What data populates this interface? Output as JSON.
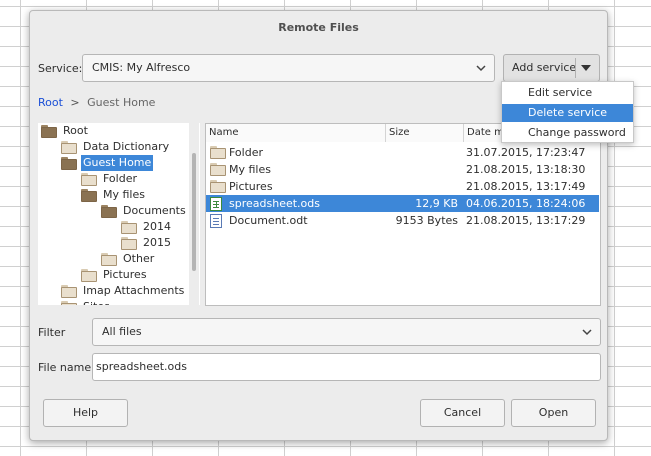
{
  "dialog": {
    "title": "Remote Files"
  },
  "service": {
    "label": "Service:",
    "value": "CMIS: My Alfresco",
    "add_button": "Add service"
  },
  "service_menu": {
    "items": [
      {
        "label": "Edit service",
        "highlighted": false
      },
      {
        "label": "Delete service",
        "highlighted": true
      },
      {
        "label": "Change password",
        "highlighted": false
      }
    ]
  },
  "breadcrumb": {
    "root": "Root",
    "separator": ">",
    "current": "Guest Home"
  },
  "tree": {
    "items": [
      {
        "label": "Root",
        "depth": 0,
        "open": true,
        "selected": false
      },
      {
        "label": "Data Dictionary",
        "depth": 1,
        "open": false,
        "selected": false
      },
      {
        "label": "Guest Home",
        "depth": 1,
        "open": true,
        "selected": true
      },
      {
        "label": "Folder",
        "depth": 2,
        "open": false,
        "selected": false
      },
      {
        "label": "My files",
        "depth": 2,
        "open": true,
        "selected": false
      },
      {
        "label": "Documents",
        "depth": 3,
        "open": true,
        "selected": false
      },
      {
        "label": "2014",
        "depth": 4,
        "open": false,
        "selected": false
      },
      {
        "label": "2015",
        "depth": 4,
        "open": false,
        "selected": false
      },
      {
        "label": "Other",
        "depth": 3,
        "open": false,
        "selected": false
      },
      {
        "label": "Pictures",
        "depth": 2,
        "open": false,
        "selected": false
      },
      {
        "label": "Imap Attachments",
        "depth": 1,
        "open": false,
        "selected": false
      },
      {
        "label": "Sites",
        "depth": 1,
        "open": false,
        "selected": false
      }
    ]
  },
  "files": {
    "columns": {
      "name": "Name",
      "size": "Size",
      "date": "Date mo"
    },
    "rows": [
      {
        "name": "Folder",
        "size": "",
        "date": "31.07.2015, 17:23:47",
        "icon": "folder-icon",
        "selected": false
      },
      {
        "name": "My files",
        "size": "",
        "date": "21.08.2015, 13:18:30",
        "icon": "folder-icon",
        "selected": false
      },
      {
        "name": "Pictures",
        "size": "",
        "date": "21.08.2015, 13:17:49",
        "icon": "folder-icon",
        "selected": false
      },
      {
        "name": "spreadsheet.ods",
        "size": "12,9 KB",
        "date": "04.06.2015, 18:24:06",
        "icon": "spreadsheet-icon",
        "selected": true
      },
      {
        "name": "Document.odt",
        "size": "9153 Bytes",
        "date": "21.08.2015, 13:17:29",
        "icon": "document-icon",
        "selected": false
      }
    ]
  },
  "filter": {
    "label": "Filter",
    "value": "All files"
  },
  "filename": {
    "label": "File name",
    "value": "spreadsheet.ods"
  },
  "buttons": {
    "help": "Help",
    "cancel": "Cancel",
    "open": "Open"
  },
  "colors": {
    "selection": "#3d87d8",
    "link": "#1a4fd6"
  }
}
